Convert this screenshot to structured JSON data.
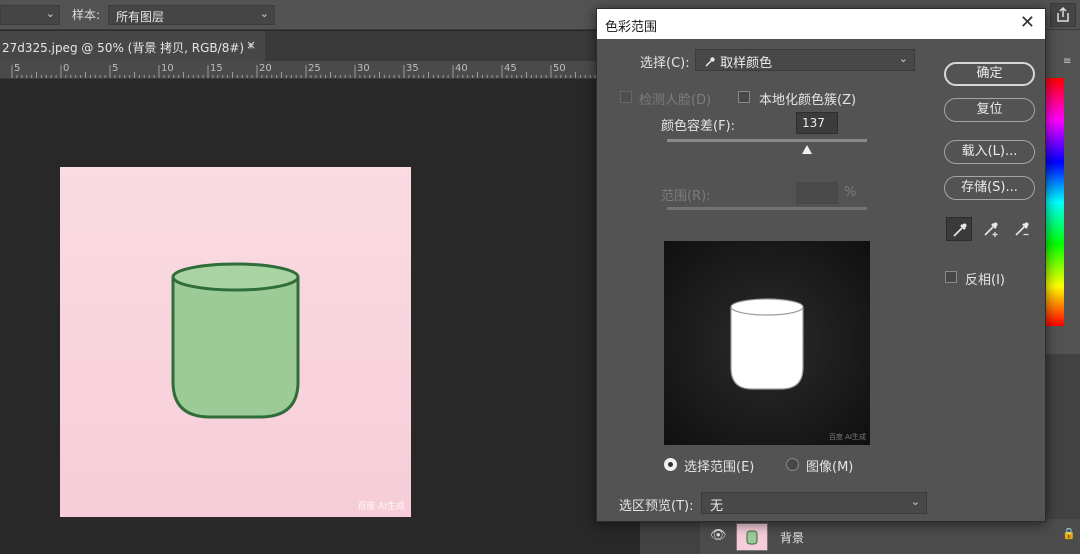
{
  "options_bar": {
    "sample_label": "样本:",
    "sample_value": "所有图层"
  },
  "document_tab": {
    "title": "27d325.jpeg @ 50% (背景 拷贝, RGB/8#) *",
    "close": "×"
  },
  "ruler": {
    "labels": [
      "5",
      "0",
      "5",
      "10",
      "15",
      "20",
      "25",
      "30",
      "35",
      "40",
      "45",
      "50"
    ]
  },
  "canvas": {
    "watermark": "百度 AI生成"
  },
  "layers": {
    "row_name": "背景"
  },
  "dialog": {
    "title": "色彩范围",
    "close": "✕",
    "select_label": "选择(C):",
    "select_value": "取样颜色",
    "detect_faces_label": "检测人脸(D)",
    "localized_clusters_label": "本地化颜色簇(Z)",
    "fuzziness_label": "颜色容差(F):",
    "fuzziness_value": "137",
    "fuzziness_fraction": 0.7,
    "range_label": "范围(R):",
    "range_value": "",
    "range_unit": "%",
    "preview_watermark": "百度 AI生成",
    "radio_selection": "选择范围(E)",
    "radio_image": "图像(M)",
    "selection_preview_label": "选区预览(T):",
    "selection_preview_value": "无",
    "buttons": {
      "ok": "确定",
      "reset": "复位",
      "load": "载入(L)...",
      "save": "存储(S)..."
    },
    "invert_label": "反相(I)",
    "colors": {
      "accent_knob": "#f0f0f0",
      "cup_fill": "#9dcb98",
      "cup_stroke": "#2f6d3a",
      "doc_bg": "#f8d3dc"
    }
  }
}
